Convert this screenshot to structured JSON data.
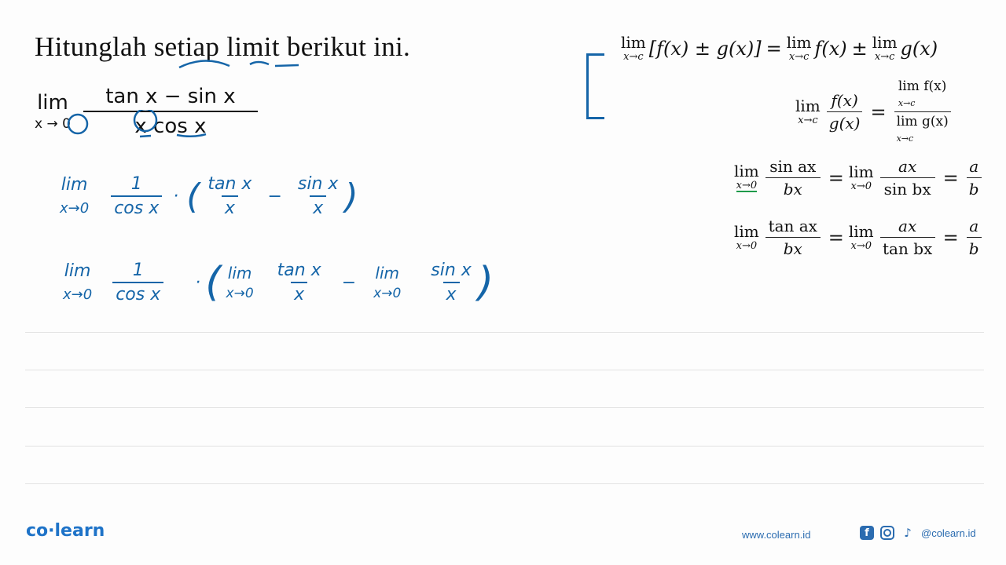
{
  "title": "Hitunglah setiap limit berikut ini.",
  "problem": {
    "lim_word": "lim",
    "lim_sub": "x → 0",
    "numerator": "tan x − sin x",
    "denominator": "x cos x"
  },
  "rules": {
    "sum_rule": {
      "lhs_lim": "lim",
      "lhs_sub": "x→c",
      "lhs_expr": "[f(x) ± g(x)]",
      "eq": "=",
      "rhs_lim1": "lim",
      "rhs_sub1": "x→c",
      "rhs_expr1": "f(x)",
      "pm": "±",
      "rhs_lim2": "lim",
      "rhs_sub2": "x→c",
      "rhs_expr2": "g(x)"
    },
    "quotient_rule": {
      "lim": "lim",
      "sub": "x→c",
      "num": "f(x)",
      "den": "g(x)",
      "eq": "=",
      "rnum": "lim f(x)",
      "rnum_sub": "x→c",
      "rden": "lim g(x)",
      "rden_sub": "x→c"
    },
    "sin_rule": {
      "lim": "lim",
      "sub": "x→0",
      "num1": "sin ax",
      "den1": "bx",
      "eq": "=",
      "num2": "ax",
      "den2": "sin bx",
      "num3": "a",
      "den3": "b"
    },
    "tan_rule": {
      "lim": "lim",
      "sub": "x→0",
      "num1": "tan ax",
      "den1": "bx",
      "eq": "=",
      "num2": "ax",
      "den2": "tan bx",
      "num3": "a",
      "den3": "b"
    }
  },
  "handwriting": {
    "step1": {
      "lim": "lim",
      "sub": "x→0",
      "f1_num": "1",
      "f1_den": "cos x",
      "dot": "·",
      "open": "(",
      "f2_num": "tan x",
      "f2_den": "x",
      "minus": "−",
      "f3_num": "sin x",
      "f3_den": "x",
      "close": ")"
    },
    "step2": {
      "lim": "lim",
      "sub": "x→0",
      "f1_num": "1",
      "f1_den": "cos x",
      "dot": "·",
      "open": "(",
      "lim2": "lim",
      "sub2": "x→0",
      "f2_num": "tan x",
      "f2_den": "x",
      "minus": "−",
      "lim3": "lim",
      "sub3": "x→0",
      "f3_num": "sin x",
      "f3_den": "x",
      "close": ")"
    }
  },
  "footer": {
    "logo": "co·learn",
    "url": "www.colearn.id",
    "social_icons": [
      "facebook-icon",
      "instagram-icon",
      "tiktok-icon"
    ],
    "handle": "@colearn.id",
    "facebook_glyph": "f",
    "tiktok_glyph": "♪"
  },
  "colors": {
    "ink_blue": "#1565a8",
    "ink_green": "#1f9a4a",
    "brand_blue": "#1e73c8"
  }
}
